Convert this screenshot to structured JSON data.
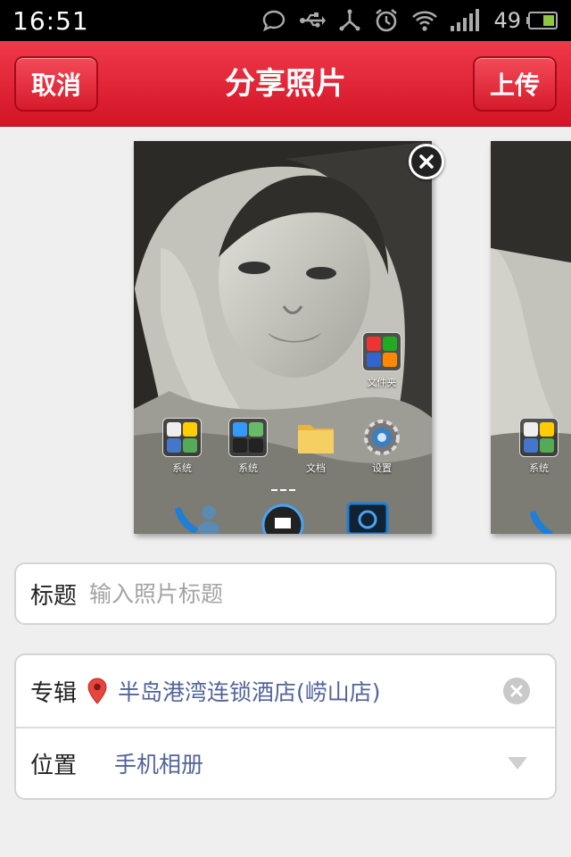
{
  "status_bar": {
    "time": "16:51",
    "battery_level": "49",
    "icons": [
      "chat-icon",
      "usb-icon",
      "usb-debug-icon",
      "alarm-icon",
      "wifi-icon",
      "signal-icon",
      "battery-icon"
    ]
  },
  "header": {
    "cancel_label": "取消",
    "title": "分享照片",
    "upload_label": "上传"
  },
  "photo": {
    "apps": {
      "folder": "文件夹",
      "system1": "系统",
      "system2": "系统",
      "docs": "文档",
      "settings": "设置"
    },
    "next_preview_label": "系统"
  },
  "title_field": {
    "label": "标题",
    "placeholder": "输入照片标题",
    "value": ""
  },
  "album_field": {
    "label": "专辑",
    "value": "半岛港湾连锁酒店(崂山店)"
  },
  "location_field": {
    "label": "位置",
    "value": "手机相册"
  },
  "colors": {
    "header_red": "#e0243a",
    "link_blue": "#53649a",
    "background": "#efefef"
  }
}
